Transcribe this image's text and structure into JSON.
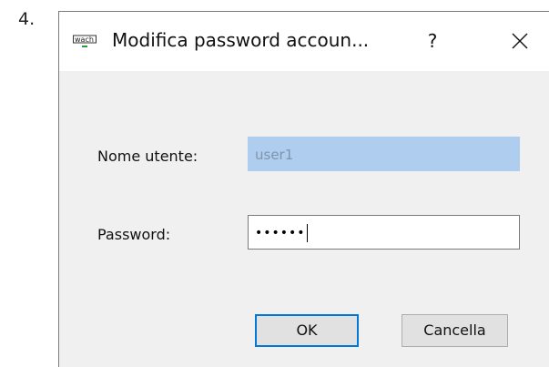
{
  "step": {
    "number": "4."
  },
  "window": {
    "title": "Modifica password accoun...",
    "help_label": "?",
    "icon": "app-logo-icon",
    "close_icon": "close-icon"
  },
  "form": {
    "username_label": "Nome utente:",
    "username_value": "user1",
    "password_label": "Password:",
    "password_value": "••••••"
  },
  "buttons": {
    "ok_label": "OK",
    "cancel_label": "Cancella"
  },
  "colors": {
    "focus_border": "#0078d7",
    "disabled_field_bg": "#aecdef",
    "dialog_bg": "#f0f0f0"
  }
}
